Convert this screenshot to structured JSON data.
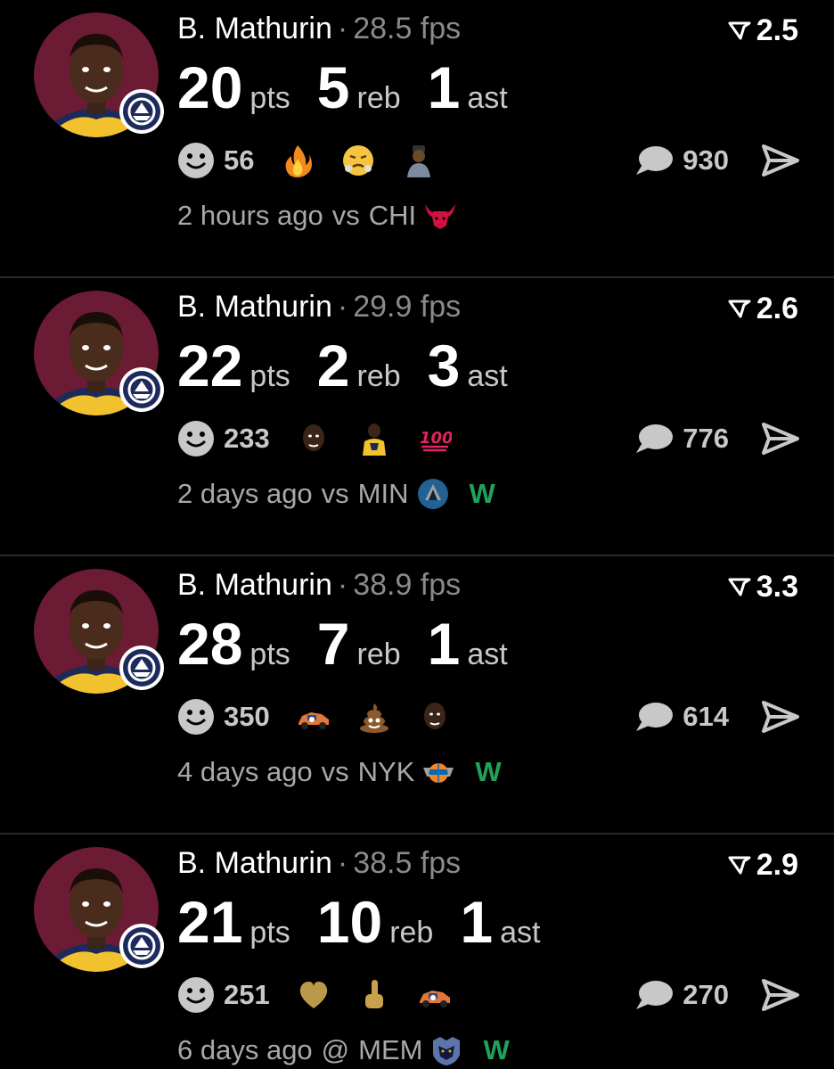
{
  "colors": {
    "background": "#000000",
    "muted": "#8a8a8a",
    "win": "#1fa35a",
    "avatar_bg": "#6b1b33"
  },
  "cards": [
    {
      "player": "B. Mathurin",
      "fps": "28.5 fps",
      "line": "2.5",
      "pts": "20",
      "reb": "5",
      "ast": "1",
      "pts_label": "pts",
      "reb_label": "reb",
      "ast_label": "ast",
      "reactions_count": "56",
      "reactions": [
        "fire-emoji",
        "steam-face-emoji",
        "person-emoji"
      ],
      "comments": "930",
      "time": "2 hours ago",
      "opponent_prefix": "vs",
      "opponent": "CHI",
      "team_logo": "bulls-logo",
      "result": ""
    },
    {
      "player": "B. Mathurin",
      "fps": "29.9 fps",
      "line": "2.6",
      "pts": "22",
      "reb": "2",
      "ast": "3",
      "pts_label": "pts",
      "reb_label": "reb",
      "ast_label": "ast",
      "reactions_count": "233",
      "reactions": [
        "player-face-emoji",
        "player-emoji",
        "hundred-emoji"
      ],
      "comments": "776",
      "time": "2 days ago",
      "opponent_prefix": "vs",
      "opponent": "MIN",
      "team_logo": "timberwolves-logo",
      "result": "W"
    },
    {
      "player": "B. Mathurin",
      "fps": "38.9 fps",
      "line": "3.3",
      "pts": "28",
      "reb": "7",
      "ast": "1",
      "pts_label": "pts",
      "reb_label": "reb",
      "ast_label": "ast",
      "reactions_count": "350",
      "reactions": [
        "race-car-emoji",
        "poop-emoji",
        "player-face-emoji"
      ],
      "comments": "614",
      "time": "4 days ago",
      "opponent_prefix": "vs",
      "opponent": "NYK",
      "team_logo": "knicks-logo",
      "result": "W"
    },
    {
      "player": "B. Mathurin",
      "fps": "38.5 fps",
      "line": "2.9",
      "pts": "21",
      "reb": "10",
      "ast": "1",
      "pts_label": "pts",
      "reb_label": "reb",
      "ast_label": "ast",
      "reactions_count": "251",
      "reactions": [
        "gold-heart-emoji",
        "gold-finger-emoji",
        "race-car-emoji"
      ],
      "comments": "270",
      "time": "6 days ago",
      "opponent_prefix": "@",
      "opponent": "MEM",
      "team_logo": "grizzlies-logo",
      "result": "W"
    }
  ]
}
